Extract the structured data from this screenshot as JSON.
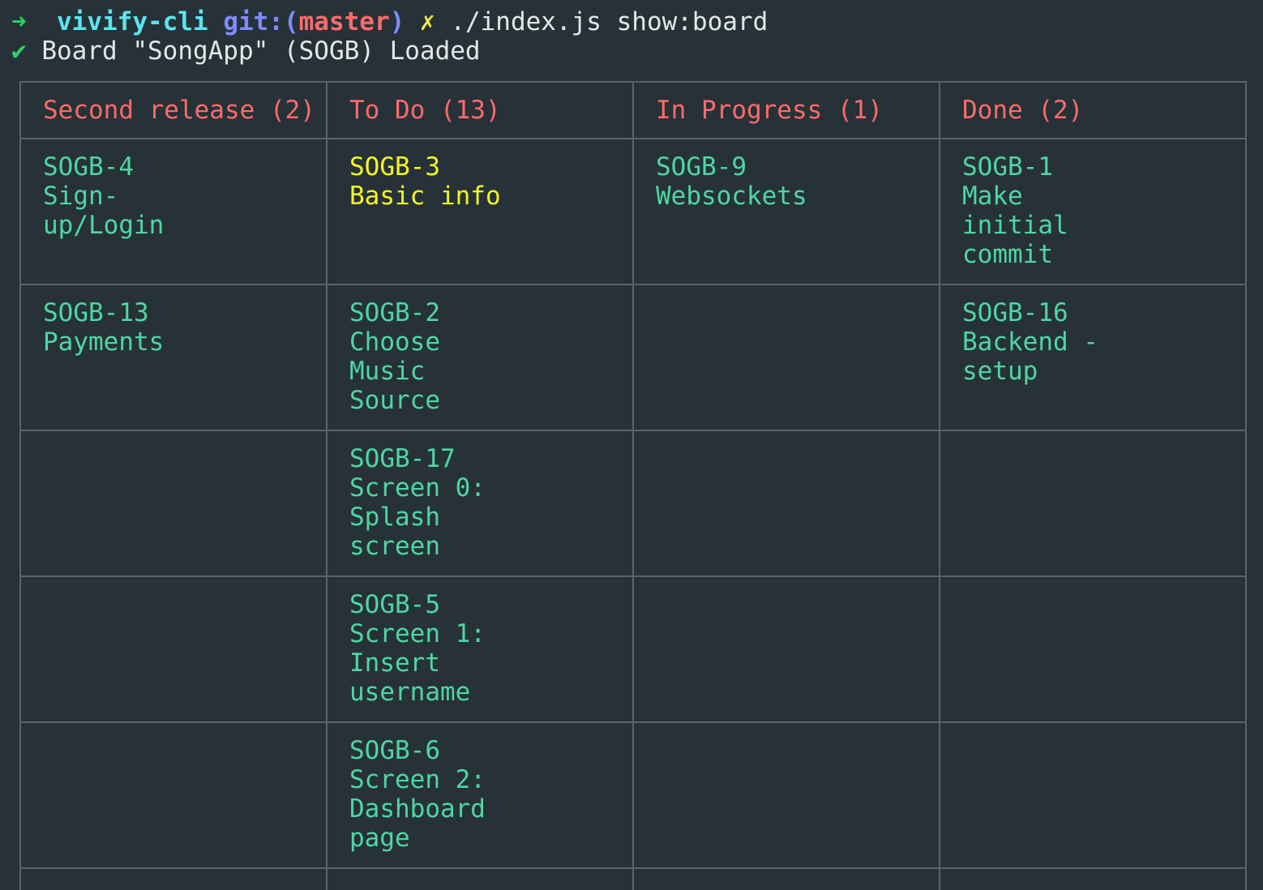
{
  "prompt": {
    "arrow": "➜",
    "directory": "vivify-cli",
    "git_label": "git:(",
    "branch": "master",
    "git_close": ")",
    "dirty_marker": "✗",
    "command": "./index.js show:board"
  },
  "status": {
    "check": "✔",
    "message": "Board \"SongApp\" (SOGB) Loaded"
  },
  "board": {
    "columns": [
      "Second release (2)",
      "To Do (13)",
      "In Progress (1)",
      "Done (2)"
    ],
    "rows": [
      [
        {
          "id": "SOGB-4",
          "title": "Sign-up/Login"
        },
        {
          "id": "SOGB-3",
          "title": "Basic info"
        },
        {
          "id": "SOGB-9",
          "title": "Websockets"
        },
        {
          "id": "SOGB-1",
          "title": "Make initial commit"
        }
      ],
      [
        {
          "id": "SOGB-13",
          "title": "Payments"
        },
        {
          "id": "SOGB-2",
          "title": "Choose Music Source"
        },
        {
          "id": "",
          "title": ""
        },
        {
          "id": "SOGB-16",
          "title": "Backend - setup"
        }
      ],
      [
        {
          "id": "",
          "title": ""
        },
        {
          "id": "SOGB-17",
          "title": "Screen 0: Splash screen"
        },
        {
          "id": "",
          "title": ""
        },
        {
          "id": "",
          "title": ""
        }
      ],
      [
        {
          "id": "",
          "title": ""
        },
        {
          "id": "SOGB-5",
          "title": "Screen 1: Insert username"
        },
        {
          "id": "",
          "title": ""
        },
        {
          "id": "",
          "title": ""
        }
      ],
      [
        {
          "id": "",
          "title": ""
        },
        {
          "id": "SOGB-6",
          "title": "Screen 2: Dashboard page"
        },
        {
          "id": "",
          "title": ""
        },
        {
          "id": "",
          "title": ""
        }
      ]
    ],
    "selected_card": "SOGB-3"
  },
  "colors": {
    "background": "#263238",
    "header_text": "#ff6b6b",
    "card_text": "#4fd6a2",
    "selected_text": "#f7f71f",
    "border": "#5b6367"
  }
}
